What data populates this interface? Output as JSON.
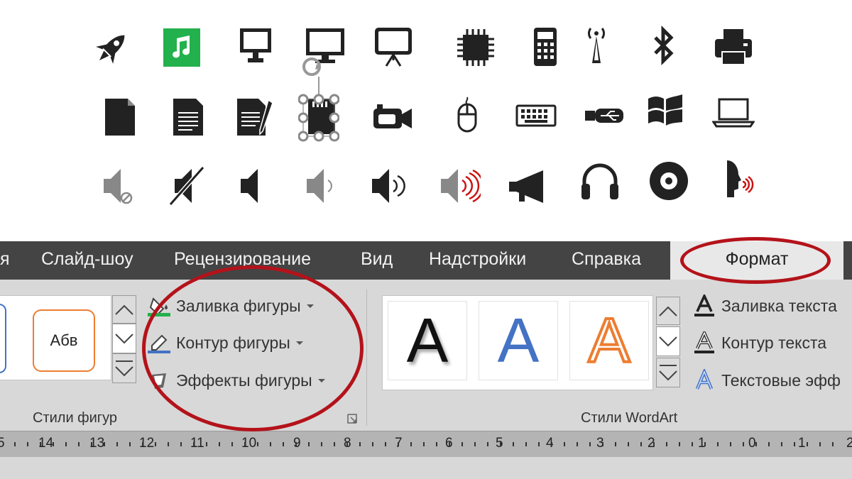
{
  "icons": {
    "row1": [
      "rocket-icon",
      "music-note-icon",
      "monitor-icon",
      "monitor-selected-icon",
      "presentation-screen-icon",
      "chip-icon",
      "calculator-icon",
      "antenna-icon",
      "bluetooth-icon",
      "printer-icon"
    ],
    "row2": [
      "blank-document-icon",
      "text-document-icon",
      "edit-document-icon",
      "sd-card-icon",
      "video-camera-icon",
      "mouse-icon",
      "keyboard-icon",
      "usb-icon",
      "windows-logo-icon",
      "laptop-icon"
    ],
    "row3": [
      "speaker-muted-icon",
      "speaker-off-icon",
      "speaker-icon",
      "speaker-low-icon",
      "speaker-medium-icon",
      "speaker-high-icon",
      "megaphone-icon",
      "headphones-icon",
      "disc-icon",
      "voice-head-icon"
    ]
  },
  "tabs": [
    {
      "label": "я"
    },
    {
      "label": "Слайд-шоу"
    },
    {
      "label": "Рецензирование"
    },
    {
      "label": "Вид"
    },
    {
      "label": "Надстройки"
    },
    {
      "label": "Справка"
    },
    {
      "label": "Формат"
    }
  ],
  "shape_styles": {
    "thumb_text": "Абв",
    "fill": "Заливка фигуры",
    "outline": "Контур фигуры",
    "effects": "Эффекты фигуры",
    "group_label": "Стили фигур"
  },
  "wordart": {
    "letters": [
      "A",
      "A",
      "A"
    ],
    "text_fill": "Заливка текста",
    "text_outline": "Контур текста",
    "text_effects": "Текстовые эфф",
    "group_label": "Стили WordArt"
  },
  "ruler": {
    "labels": [
      "5",
      "14",
      "13",
      "12",
      "11",
      "10",
      "9",
      "8",
      "7",
      "6",
      "5",
      "4",
      "3",
      "2",
      "1",
      "0",
      "1",
      "2"
    ]
  },
  "colors": {
    "highlight": "#b4121a",
    "music_green": "#22b14c",
    "tab_bar": "#444444",
    "ribbon": "#d8d8d8",
    "wordart_blue": "#4472c4",
    "wordart_orange": "#ed7d31"
  }
}
